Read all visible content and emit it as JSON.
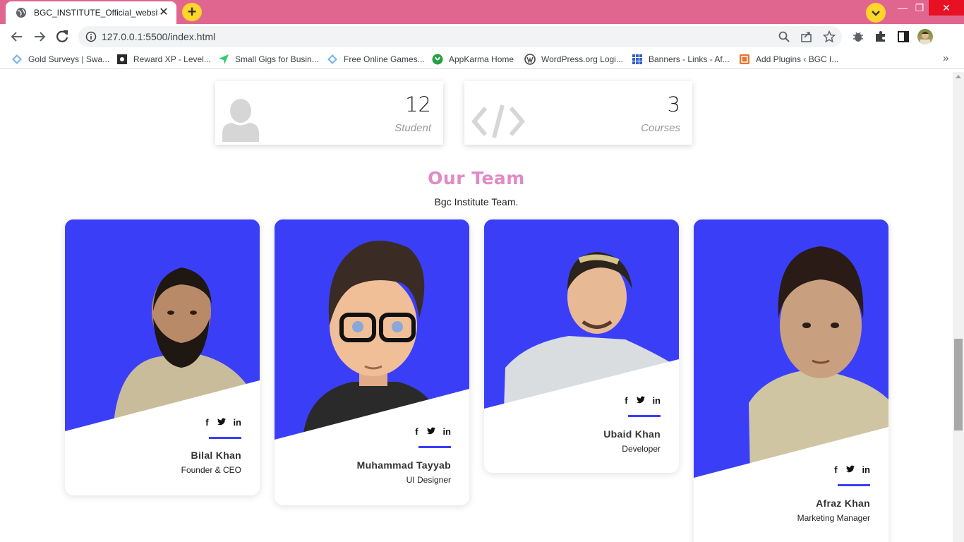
{
  "browser": {
    "tab_title": "BGC_INSTITUTE_Official_website",
    "tab_close": "✕",
    "new_tab": "+",
    "url": "127.0.0.1:5500/index.html",
    "win_min": "—",
    "win_max": "❐",
    "win_close": "✕",
    "accent_color": "#e0668f"
  },
  "bookmarks": [
    {
      "label": "Gold Surveys | Swa...",
      "icon": "diamond-icon"
    },
    {
      "label": "Reward XP - Level...",
      "icon": "rewardxp-icon"
    },
    {
      "label": "Small Gigs for Busin...",
      "icon": "arrow-icon"
    },
    {
      "label": "Free Online Games...",
      "icon": "diamond-icon"
    },
    {
      "label": "AppKarma Home",
      "icon": "appkarma-icon"
    },
    {
      "label": "WordPress.org Logi...",
      "icon": "wordpress-icon"
    },
    {
      "label": "Banners - Links - Af...",
      "icon": "grid-icon"
    },
    {
      "label": "Add Plugins ‹ BGC I...",
      "icon": "plugin-icon"
    }
  ],
  "bookmarks_more": "»",
  "stats": [
    {
      "value": "12",
      "label": "Student",
      "icon": "user-icon"
    },
    {
      "value": "3",
      "label": "Courses",
      "icon": "code-icon"
    }
  ],
  "team": {
    "title": "Our Team",
    "subtitle": "Bgc Institute Team.",
    "social": [
      "f",
      "🐦",
      "in"
    ],
    "members": [
      {
        "name": "Bilal Khan",
        "role": "Founder & CEO"
      },
      {
        "name": "Muhammad Tayyab",
        "role": "UI Designer"
      },
      {
        "name": "Ubaid Khan",
        "role": "Developer"
      },
      {
        "name": "Afraz Khan",
        "role": "Marketing Manager"
      }
    ],
    "card_color": "#3a3ff7"
  }
}
